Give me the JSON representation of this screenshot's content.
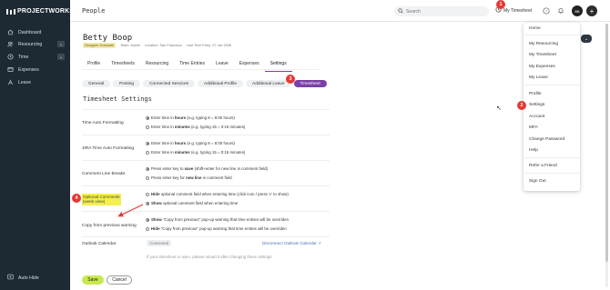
{
  "app": {
    "logo_text": "PROJECTWORKS",
    "page_title": "People"
  },
  "sidebar": {
    "items": [
      {
        "label": "Dashboard",
        "icon": "home-icon"
      },
      {
        "label": "Resourcing",
        "icon": "users-icon"
      },
      {
        "label": "Time",
        "icon": "clock-icon"
      },
      {
        "label": "Expenses",
        "icon": "receipt-icon"
      },
      {
        "label": "Leave",
        "icon": "leave-icon"
      }
    ],
    "auto_hide_label": "Auto Hide"
  },
  "topbar": {
    "search_placeholder": "Search",
    "my_timesheet_label": "My Timesheet",
    "avatar_initials": "BB",
    "badge_1": "1"
  },
  "person": {
    "name": "Betty Boop",
    "role_badge": "Designer Graduate",
    "team": "Team: Admin",
    "location": "Location: San Francisco",
    "last_entry": "Last Time Entry: 07 Jan 2026"
  },
  "tabs": [
    "Profile",
    "Timesheets",
    "Resourcing",
    "Time Entries",
    "Leave",
    "Expenses",
    "Settings"
  ],
  "active_tab": "Settings",
  "subtabs": [
    "General",
    "Posting",
    "Connected Services",
    "Additional Profile",
    "Additional Leave",
    "Timesheet"
  ],
  "active_subtab": "Timesheet",
  "badge_3": "3",
  "section_title": "Timesheet Settings",
  "settings": {
    "auto_format": {
      "label": "Time Auto Formatting",
      "opt1_pre": "Enter time in ",
      "opt1_bold": "hours",
      "opt1_post": " (e.g. typing 8 = 8:00 hours)",
      "opt2_pre": "Enter time in ",
      "opt2_bold": "minutes",
      "opt2_post": " (e.g. typing 15 = 0:15 minutes)"
    },
    "jira_format": {
      "label": "JIRA Time Auto Formatting",
      "opt1_pre": "Enter time in ",
      "opt1_bold": "hours",
      "opt1_post": " (e.g. typing 8 = 8:00 hours)",
      "opt2_pre": "Enter time in ",
      "opt2_bold": "minutes",
      "opt2_post": " (e.g. typing 15 = 0:15 minutes)"
    },
    "line_breaks": {
      "label": "Comment Line Breaks",
      "opt1_pre": "Press enter key to ",
      "opt1_bold": "save",
      "opt1_post": " (shift+enter for new line in comment field)",
      "opt2_pre": "Press enter key for ",
      "opt2_bold": "new line",
      "opt2_post": " in comment field"
    },
    "optional_comments": {
      "label_line1": "Optional Comments",
      "label_line2": "(week view)",
      "badge": "4",
      "opt1_bold": "Hide",
      "opt1_post": " optional comment field when entering time (click icon / press 'c' to show)",
      "opt2_bold": "Show",
      "opt2_post": " optional comment field when entering time"
    },
    "copy_warning": {
      "label": "Copy from previous warning",
      "opt1_bold": "Show",
      "opt1_post": " \"Copy from previous\" pop-up warning that time entries will be overriden",
      "opt2_bold": "Hide",
      "opt2_post": " \"Copy from previous\" pop-up warning that time entries will be overriden"
    },
    "outlook": {
      "label": "Outlook Calendar",
      "status": "Connected",
      "disconnect": "Disconnect Outlook Calendar"
    },
    "note": "If your timesheet is open, please reload it after changing these settings"
  },
  "buttons": {
    "save": "Save",
    "cancel": "Cancel"
  },
  "menu": {
    "group1": [
      "Home"
    ],
    "group2": [
      "My Resourcing",
      "My Timesheet",
      "My Expenses",
      "My Leave"
    ],
    "group3": [
      "Profile",
      "Settings",
      "Account",
      "MFA",
      "Change Password",
      "Help"
    ],
    "group4": [
      "Refer a Friend"
    ],
    "group5": [
      "Sign Out"
    ],
    "settings_badge": "2"
  },
  "colors": {
    "sidebar": "#1e2a33",
    "accent": "#7b3fa8",
    "save": "#c7e84e",
    "badge": "#e53935",
    "highlight": "#f4ef4f"
  }
}
